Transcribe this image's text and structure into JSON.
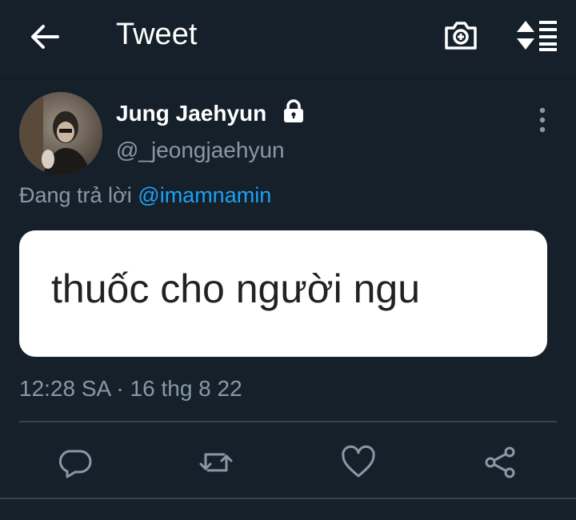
{
  "header": {
    "title": "Tweet",
    "icons": [
      "back-arrow-icon",
      "camera-add-icon",
      "sort-icon"
    ]
  },
  "tweet": {
    "author_name": "Jung Jaehyun",
    "author_handle": "@_jeongjaehyun",
    "protected": true,
    "reply_prefix": "Đang trả lời",
    "reply_mention": "@imamnamin",
    "image_text": "thuốc cho người ngu",
    "timestamp": "12:28 SA · 16 thg 8 22"
  },
  "actions": [
    "reply-icon",
    "retweet-icon",
    "like-icon",
    "share-icon"
  ],
  "colors": {
    "background": "#15202b",
    "secondary_text": "#8899a6",
    "accent": "#1da1f2",
    "divider": "#38444d"
  }
}
